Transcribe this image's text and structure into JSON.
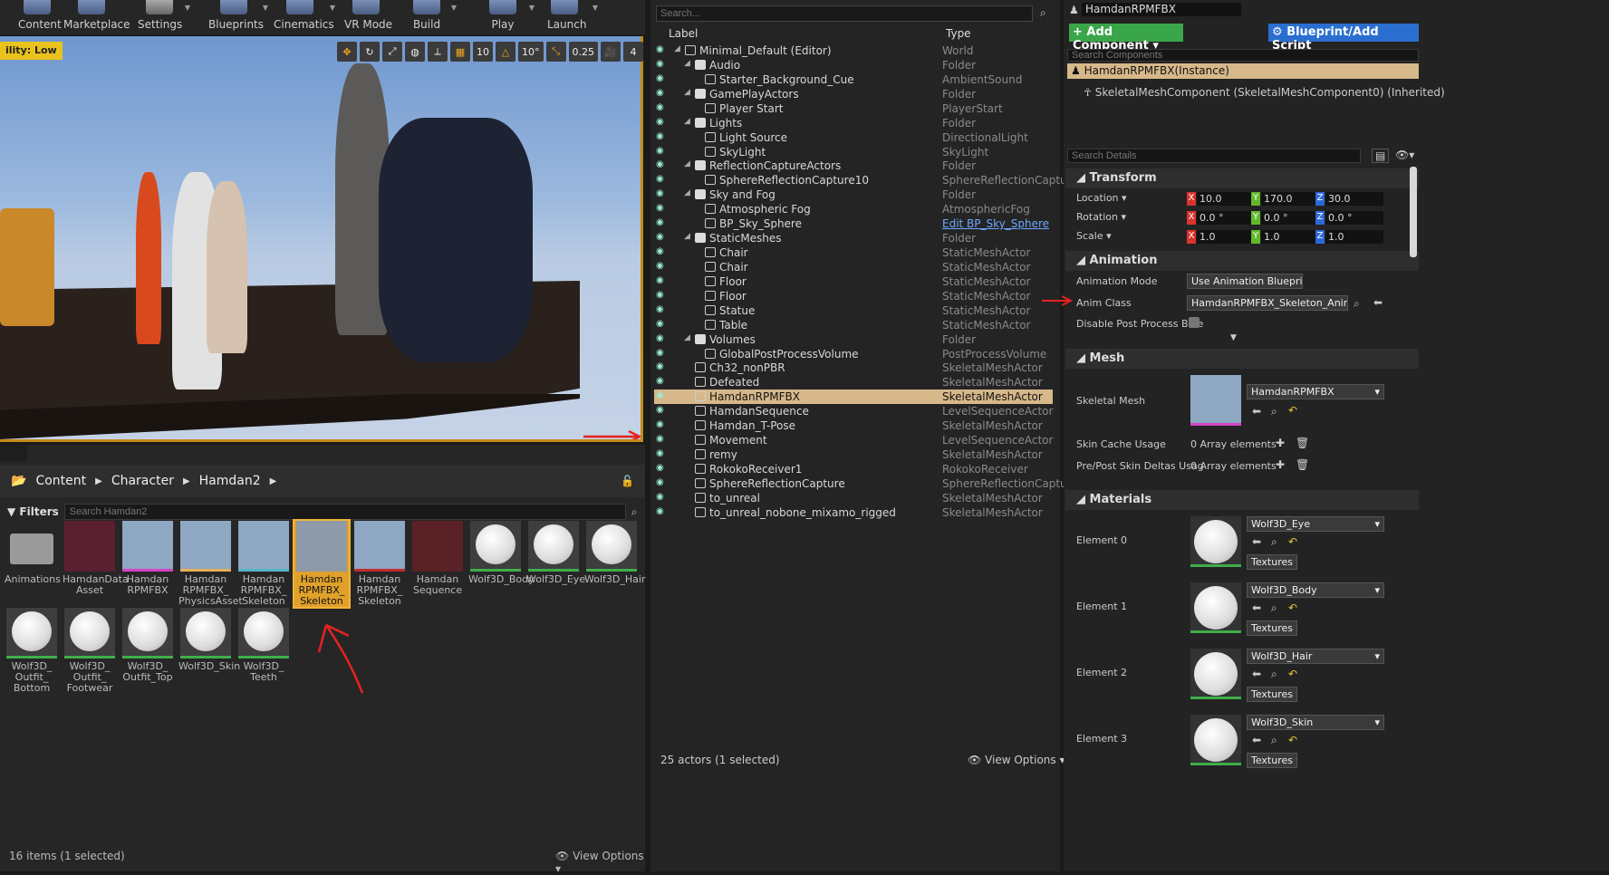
{
  "toolbar": {
    "items": [
      "Content",
      "Marketplace",
      "Settings",
      "Blueprints",
      "Cinematics",
      "VR Mode",
      "Build",
      "Play",
      "Launch"
    ]
  },
  "viewport": {
    "quality": "ility: Low",
    "tools": {
      "grid": "10",
      "angle": "10°",
      "scale": "0.25",
      "speed": "4"
    }
  },
  "content_browser": {
    "path": [
      "Content",
      "Character",
      "Hamdan2"
    ],
    "filters": "Filters",
    "search_placeholder": "Search Hamdan2",
    "assets": [
      {
        "name": "Animations",
        "kind": "folder"
      },
      {
        "name": "HamdanData Asset",
        "kind": "data"
      },
      {
        "name": "Hamdan RPMFBX",
        "kind": "mesh",
        "bar": "#d642c6"
      },
      {
        "name": "Hamdan RPMFBX_ PhysicsAsset",
        "kind": "mesh",
        "bar": "#e5b25a"
      },
      {
        "name": "Hamdan RPMFBX_ Skeleton",
        "kind": "skel",
        "bar": "#5ab4c8"
      },
      {
        "name": "Hamdan RPMFBX_ Skeleton",
        "kind": "anim",
        "selected": true
      },
      {
        "name": "Hamdan RPMFBX_ Skeleton",
        "kind": "pose",
        "bar": "#c42c2c"
      },
      {
        "name": "Hamdan Sequence",
        "kind": "seq"
      },
      {
        "name": "Wolf3D_Body",
        "kind": "mat"
      },
      {
        "name": "Wolf3D_Eye",
        "kind": "mat"
      },
      {
        "name": "Wolf3D_Hair",
        "kind": "mat"
      },
      {
        "name": "Wolf3D_ Outfit_ Bottom",
        "kind": "mat"
      },
      {
        "name": "Wolf3D_ Outfit_ Footwear",
        "kind": "mat"
      },
      {
        "name": "Wolf3D_ Outfit_Top",
        "kind": "mat"
      },
      {
        "name": "Wolf3D_Skin",
        "kind": "mat"
      },
      {
        "name": "Wolf3D_ Teeth",
        "kind": "mat"
      }
    ],
    "status": "16 items (1 selected)",
    "view_options": "View Options"
  },
  "outliner": {
    "search_placeholder": "Search...",
    "col_label": "Label",
    "col_type": "Type",
    "rows": [
      {
        "label": "Minimal_Default (Editor)",
        "type": "World",
        "depth": 0,
        "arrow": true
      },
      {
        "label": "Audio",
        "type": "Folder",
        "depth": 1,
        "folder": true,
        "arrow": true
      },
      {
        "label": "Starter_Background_Cue",
        "type": "AmbientSound",
        "depth": 2
      },
      {
        "label": "GamePlayActors",
        "type": "Folder",
        "depth": 1,
        "folder": true,
        "arrow": true
      },
      {
        "label": "Player Start",
        "type": "PlayerStart",
        "depth": 2
      },
      {
        "label": "Lights",
        "type": "Folder",
        "depth": 1,
        "folder": true,
        "arrow": true
      },
      {
        "label": "Light Source",
        "type": "DirectionalLight",
        "depth": 2
      },
      {
        "label": "SkyLight",
        "type": "SkyLight",
        "depth": 2
      },
      {
        "label": "ReflectionCaptureActors",
        "type": "Folder",
        "depth": 1,
        "folder": true,
        "arrow": true
      },
      {
        "label": "SphereReflectionCapture10",
        "type": "SphereReflectionCapture",
        "depth": 2
      },
      {
        "label": "Sky and Fog",
        "type": "Folder",
        "depth": 1,
        "folder": true,
        "arrow": true
      },
      {
        "label": "Atmospheric Fog",
        "type": "AtmosphericFog",
        "depth": 2
      },
      {
        "label": "BP_Sky_Sphere",
        "type": "Edit BP_Sky_Sphere",
        "depth": 2,
        "link": true
      },
      {
        "label": "StaticMeshes",
        "type": "Folder",
        "depth": 1,
        "folder": true,
        "arrow": true
      },
      {
        "label": "Chair",
        "type": "StaticMeshActor",
        "depth": 2
      },
      {
        "label": "Chair",
        "type": "StaticMeshActor",
        "depth": 2
      },
      {
        "label": "Floor",
        "type": "StaticMeshActor",
        "depth": 2
      },
      {
        "label": "Floor",
        "type": "StaticMeshActor",
        "depth": 2
      },
      {
        "label": "Statue",
        "type": "StaticMeshActor",
        "depth": 2
      },
      {
        "label": "Table",
        "type": "StaticMeshActor",
        "depth": 2
      },
      {
        "label": "Volumes",
        "type": "Folder",
        "depth": 1,
        "folder": true,
        "arrow": true
      },
      {
        "label": "GlobalPostProcessVolume",
        "type": "PostProcessVolume",
        "depth": 2
      },
      {
        "label": "Ch32_nonPBR",
        "type": "SkeletalMeshActor",
        "depth": 1
      },
      {
        "label": "Defeated",
        "type": "SkeletalMeshActor",
        "depth": 1
      },
      {
        "label": "HamdanRPMFBX",
        "type": "SkeletalMeshActor",
        "depth": 1,
        "selected": true
      },
      {
        "label": "HamdanSequence",
        "type": "LevelSequenceActor",
        "depth": 1
      },
      {
        "label": "Hamdan_T-Pose",
        "type": "SkeletalMeshActor",
        "depth": 1
      },
      {
        "label": "Movement",
        "type": "LevelSequenceActor",
        "depth": 1
      },
      {
        "label": "remy",
        "type": "SkeletalMeshActor",
        "depth": 1
      },
      {
        "label": "RokokoReceiver1",
        "type": "RokokoReceiver",
        "depth": 1
      },
      {
        "label": "SphereReflectionCapture",
        "type": "SphereReflectionCapture",
        "depth": 1
      },
      {
        "label": "to_unreal",
        "type": "SkeletalMeshActor",
        "depth": 1
      },
      {
        "label": "to_unreal_nobone_mixamo_rigged",
        "type": "SkeletalMeshActor",
        "depth": 1
      }
    ],
    "status": "25 actors (1 selected)",
    "view_options": "View Options"
  },
  "details": {
    "name": "HamdanRPMFBX",
    "add_component": "+ Add Component",
    "blueprint": "Blueprint/Add Script",
    "search_components": "Search Components",
    "instance": "HamdanRPMFBX(Instance)",
    "component": "SkeletalMeshComponent (SkeletalMeshComponent0) (Inherited)",
    "search_details": "Search Details",
    "transform": {
      "title": "Transform",
      "location": {
        "label": "Location",
        "x": "10.0",
        "y": "170.0",
        "z": "30.0"
      },
      "rotation": {
        "label": "Rotation",
        "x": "0.0 °",
        "y": "0.0 °",
        "z": "0.0 °"
      },
      "scale": {
        "label": "Scale",
        "x": "1.0",
        "y": "1.0",
        "z": "1.0"
      }
    },
    "animation": {
      "title": "Animation",
      "mode_label": "Animation Mode",
      "mode": "Use Animation Blueprint",
      "class_label": "Anim Class",
      "class": "HamdanRPMFBX_Skeleton_AnimBlue",
      "disable_label": "Disable Post Process Blue"
    },
    "mesh": {
      "title": "Mesh",
      "skeletal_label": "Skeletal Mesh",
      "skeletal": "HamdanRPMFBX",
      "skin_label": "Skin Cache Usage",
      "skin": "0 Array elements",
      "deltas_label": "Pre/Post Skin Deltas Usag",
      "deltas": "0 Array elements"
    },
    "materials": {
      "title": "Materials",
      "textures": "Textures",
      "elements": [
        {
          "label": "Element 0",
          "value": "Wolf3D_Eye"
        },
        {
          "label": "Element 1",
          "value": "Wolf3D_Body"
        },
        {
          "label": "Element 2",
          "value": "Wolf3D_Hair"
        },
        {
          "label": "Element 3",
          "value": "Wolf3D_Skin"
        }
      ]
    }
  },
  "colors": {
    "accent": "#f2b335",
    "selection": "#d7b88a",
    "add_component": "#3aa64a",
    "blueprint": "#2a6ed0",
    "x": "#d8332c",
    "y": "#62b82d",
    "z": "#2d68d8"
  }
}
